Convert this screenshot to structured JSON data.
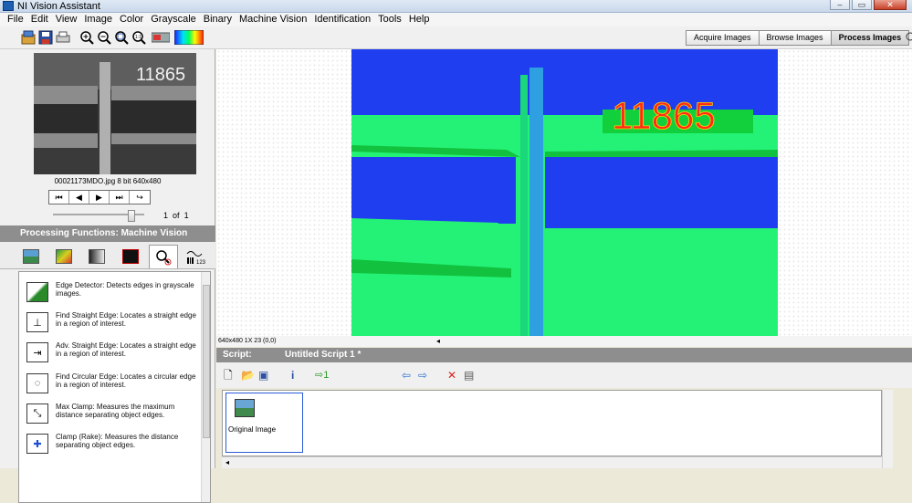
{
  "app": {
    "title": "NI Vision Assistant"
  },
  "window_buttons": [
    "–",
    "▭",
    "✕"
  ],
  "menu": [
    "File",
    "Edit",
    "View",
    "Image",
    "Color",
    "Grayscale",
    "Binary",
    "Machine Vision",
    "Identification",
    "Tools",
    "Help"
  ],
  "toolbar": {
    "icons": [
      "acquire-icon",
      "save-icon",
      "print-icon",
      "zoom-in-icon",
      "zoom-out-icon",
      "zoom-fit-icon",
      "zoom-100-icon",
      "palette-gray-icon",
      "palette-color-icon"
    ],
    "modes": [
      "Acquire Images",
      "Browse Images",
      "Process Images"
    ],
    "active_mode": "Process Images"
  },
  "browser": {
    "thumbnail_text": "11865",
    "image_info": "00021173MDO.jpg   8 bit   640x480",
    "nav": [
      "⏮",
      "◀",
      "▶",
      "⏭",
      "↪"
    ],
    "page_current": "1",
    "page_of": "of",
    "page_total": "1",
    "slider_position": 0.82
  },
  "processing": {
    "header": "Processing Functions: Machine Vision",
    "tabs": [
      "image-tab",
      "color-tab",
      "grayscale-tab",
      "binary-tab",
      "machine-vision-tab",
      "identification-tab"
    ],
    "active_tab": "machine-vision-tab",
    "functions": [
      {
        "name": "Edge Detector:",
        "desc": "Detects edges in grayscale images.",
        "icon": "edge-detector-icon"
      },
      {
        "name": "Find Straight Edge:",
        "desc": "Locates a straight edge in a region of interest.",
        "icon": "straight-edge-icon"
      },
      {
        "name": "Adv. Straight Edge:",
        "desc": "Locates a straight edge in a region of interest.",
        "icon": "adv-straight-edge-icon"
      },
      {
        "name": "Find Circular Edge:",
        "desc": "Locates a circular edge in a region of interest.",
        "icon": "circular-edge-icon"
      },
      {
        "name": "Max Clamp:",
        "desc": "Measures the maximum distance separating object edges.",
        "icon": "max-clamp-icon"
      },
      {
        "name": "Clamp (Rake):",
        "desc": "Measures the distance separating object edges.",
        "icon": "clamp-rake-icon"
      }
    ]
  },
  "image_view": {
    "overlay_text": "11865",
    "status": "640x480 1X 23   (0,0)",
    "colors": {
      "blue": "#1f3ef0",
      "green": "#22f27a",
      "red": "#ff2a1a"
    }
  },
  "script": {
    "label": "Script:",
    "title": "Untitled Script 1 *",
    "step_label": "Original Image"
  }
}
